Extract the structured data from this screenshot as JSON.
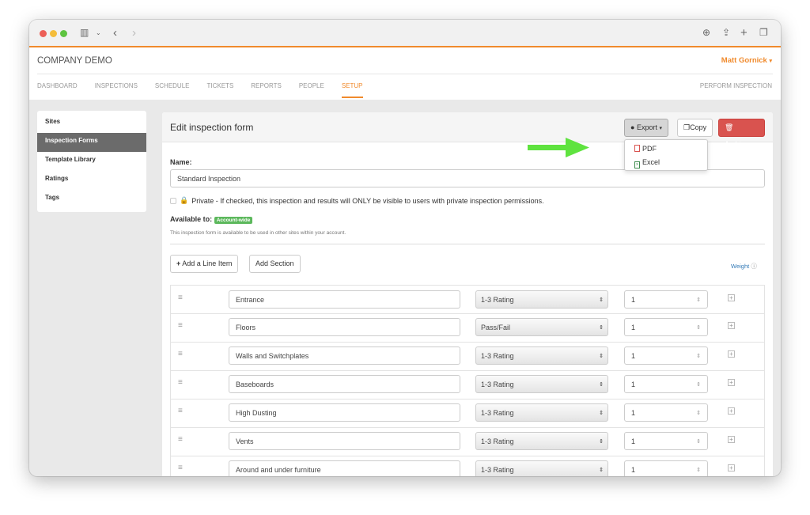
{
  "browser": {
    "icons": [
      "sidebar-icon",
      "back-icon",
      "forward-icon",
      "download-icon",
      "share-icon",
      "new-tab-icon",
      "tabs-icon"
    ]
  },
  "header": {
    "company": "COMPANY DEMO",
    "user": "Matt Gornick",
    "perform": "PERFORM INSPECTION"
  },
  "nav": [
    {
      "label": "DASHBOARD"
    },
    {
      "label": "INSPECTIONS"
    },
    {
      "label": "SCHEDULE"
    },
    {
      "label": "TICKETS"
    },
    {
      "label": "REPORTS"
    },
    {
      "label": "PEOPLE"
    },
    {
      "label": "SETUP",
      "active": true
    }
  ],
  "sidebar": [
    {
      "label": "Sites"
    },
    {
      "label": "Inspection Forms",
      "active": true
    },
    {
      "label": "Template Library"
    },
    {
      "label": "Ratings"
    },
    {
      "label": "Tags"
    }
  ],
  "main": {
    "title": "Edit inspection form",
    "export": "Export",
    "copy": "Copy",
    "archive": "Archive",
    "menu": [
      {
        "label": "PDF"
      },
      {
        "label": "Excel"
      }
    ],
    "name_label": "Name:",
    "name_value": "Standard Inspection",
    "private_text": "Private - If checked, this inspection and results will ONLY be visible to users with private inspection permissions.",
    "available_label": "Available to:",
    "available_badge": "Account-wide",
    "available_note": "This inspection form is available to be used in other sites within your account.",
    "add_line": "Add a Line Item",
    "add_section": "Add Section",
    "weight": "Weight",
    "rows": [
      {
        "name": "Entrance",
        "type": "1-3 Rating",
        "weight": "1"
      },
      {
        "name": "Floors",
        "type": "Pass/Fail",
        "weight": "1"
      },
      {
        "name": "Walls and Switchplates",
        "type": "1-3 Rating",
        "weight": "1"
      },
      {
        "name": "Baseboards",
        "type": "1-3 Rating",
        "weight": "1"
      },
      {
        "name": "High Dusting",
        "type": "1-3 Rating",
        "weight": "1"
      },
      {
        "name": "Vents",
        "type": "1-3 Rating",
        "weight": "1"
      },
      {
        "name": "Around and under furniture",
        "type": "1-3 Rating",
        "weight": "1"
      }
    ]
  },
  "colors": {
    "accent": "#f08a2c",
    "archive": "#d9534f",
    "badge": "#5cb85c",
    "arrow": "#5fe33f",
    "link": "#337ab7"
  }
}
